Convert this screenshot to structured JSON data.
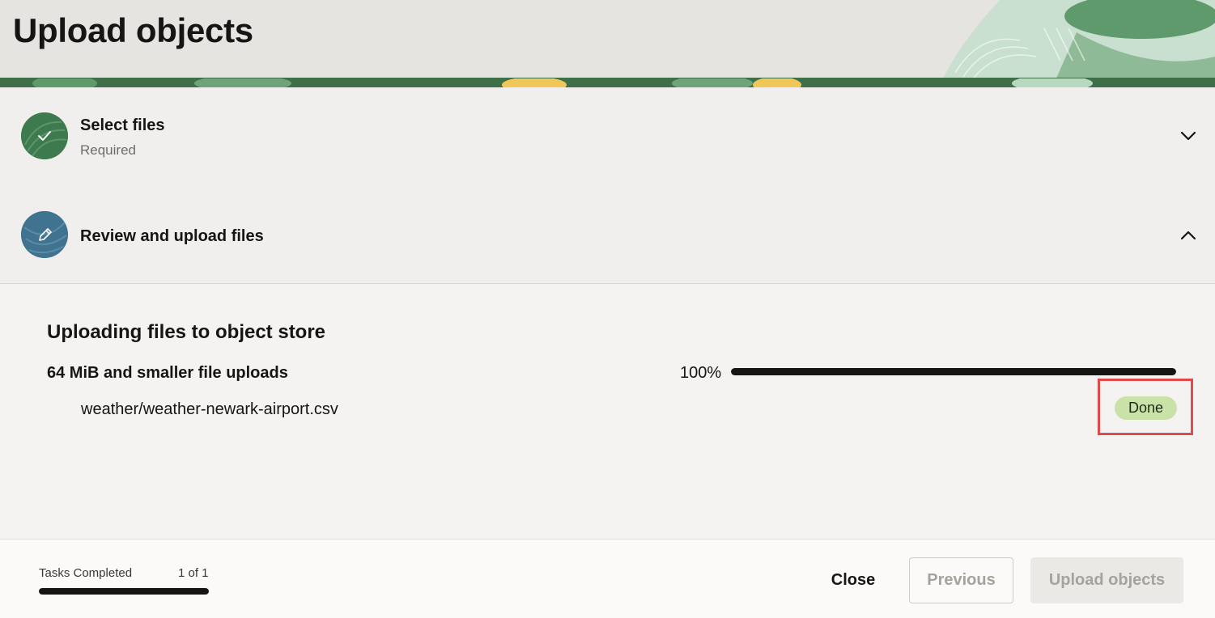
{
  "header": {
    "title": "Upload objects"
  },
  "steps": [
    {
      "title": "Select files",
      "subtitle": "Required",
      "icon": "check-icon",
      "state": "complete",
      "expanded": false
    },
    {
      "title": "Review and upload files",
      "icon": "pencil-icon",
      "state": "current",
      "expanded": true
    }
  ],
  "upload": {
    "section_title": "Uploading files to object store",
    "group_label": "64 MiB and smaller file uploads",
    "progress_text": "100%",
    "progress": 1.0,
    "files": [
      {
        "name": "weather/weather-newark-airport.csv",
        "status": "Done"
      }
    ]
  },
  "footer": {
    "tasks_label": "Tasks Completed",
    "tasks_count": "1 of 1",
    "tasks_progress": 1.0,
    "close_label": "Close",
    "previous_label": "Previous",
    "upload_label": "Upload objects"
  },
  "colors": {
    "accent_green": "#3d7a4e",
    "accent_blue": "#3f7390",
    "done_badge": "#c9e2a8",
    "highlight": "#e04a4a"
  }
}
